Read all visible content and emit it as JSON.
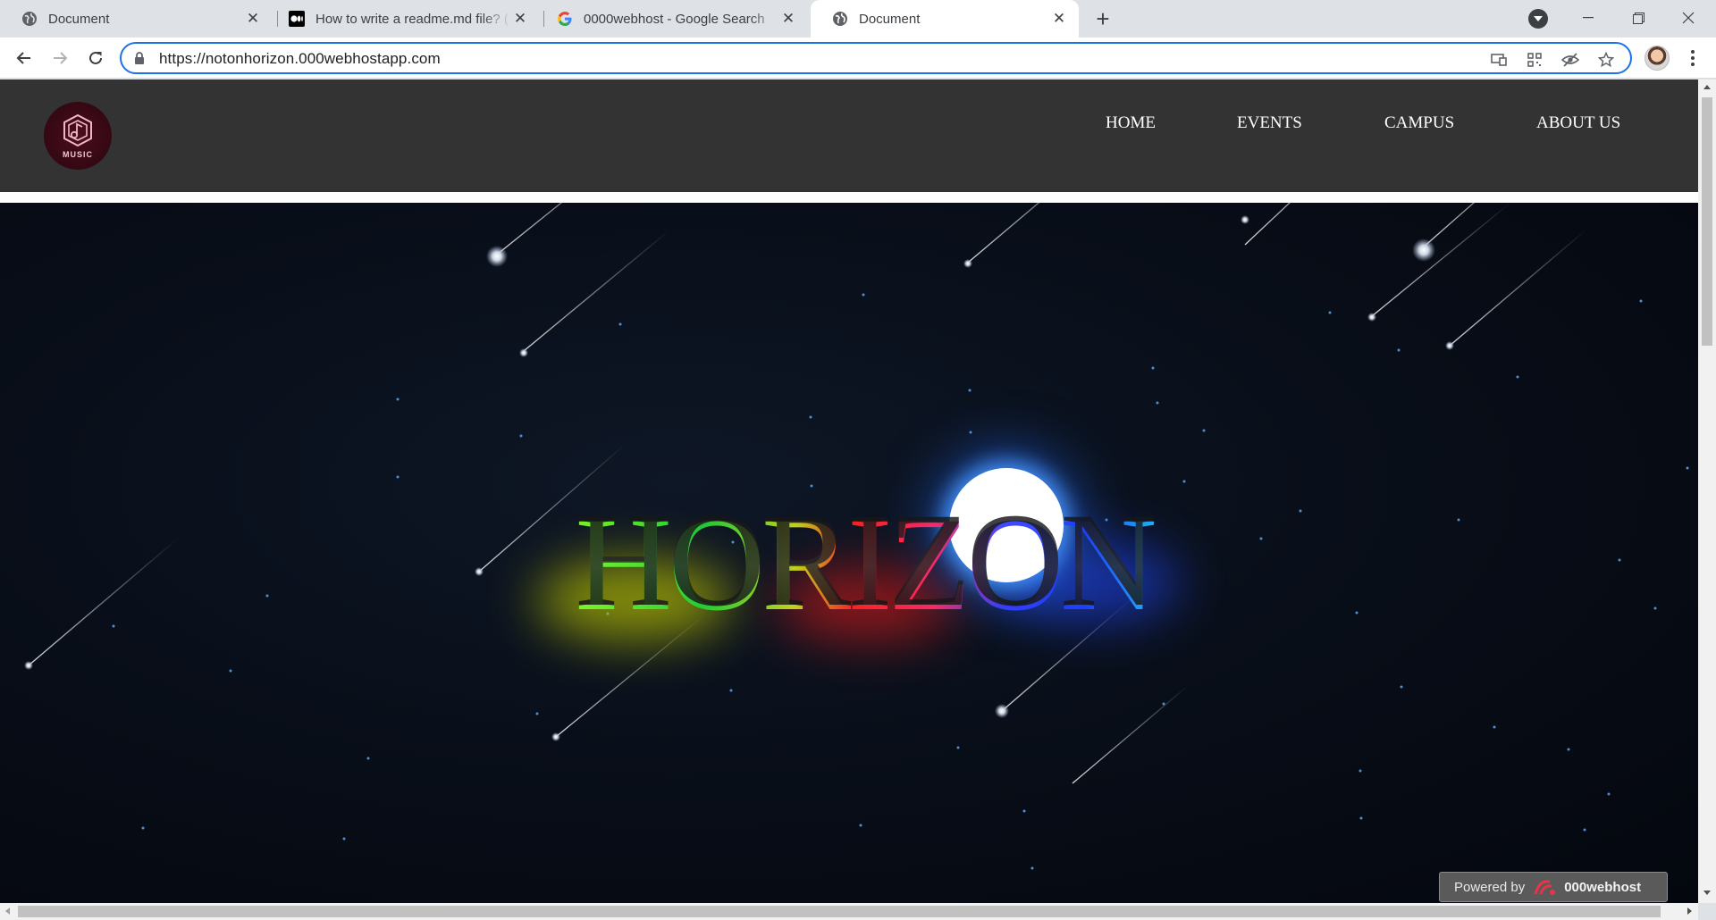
{
  "browser": {
    "tabs": [
      {
        "title": "Document",
        "icon": "globe-icon",
        "active": false
      },
      {
        "title": "How to write a readme.md file? (",
        "icon": "medium-icon",
        "active": false
      },
      {
        "title": "0000webhost - Google Search",
        "icon": "google-icon",
        "active": false
      },
      {
        "title": "Document",
        "icon": "globe-icon",
        "active": true
      }
    ],
    "url": "https://notonhorizon.000webhostapp.com"
  },
  "site": {
    "logo_text": "MUSIC",
    "nav": [
      "HOME",
      "EVENTS",
      "CAMPUS",
      "ABOUT US"
    ],
    "hero_title": "HORIZON",
    "powered_label": "Powered by",
    "powered_brand": "000webhost"
  }
}
